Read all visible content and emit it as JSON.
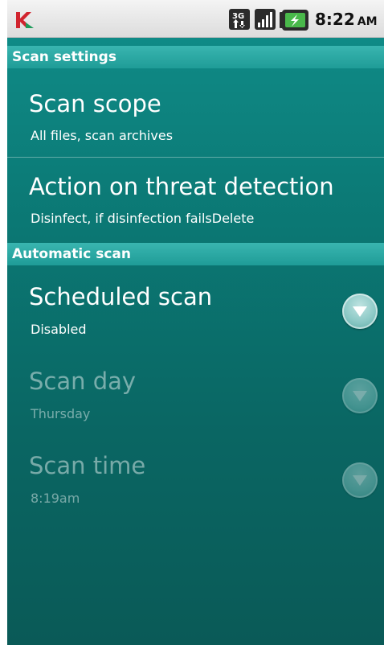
{
  "status_bar": {
    "time": "8:22",
    "ampm": "AM",
    "icons": [
      "kaspersky-logo-icon",
      "3g-data-icon",
      "signal-strength-icon",
      "battery-charging-icon"
    ]
  },
  "sections": {
    "scan_settings": {
      "header": "Scan settings",
      "items": [
        {
          "title": "Scan scope",
          "subtitle": "All files, scan archives"
        },
        {
          "title": "Action on threat detection",
          "subtitle": "Disinfect, if disinfection failsDelete"
        }
      ]
    },
    "automatic_scan": {
      "header": "Automatic scan",
      "items": [
        {
          "title": "Scheduled scan",
          "subtitle": "Disabled",
          "enabled": true
        },
        {
          "title": "Scan day",
          "subtitle": "Thursday",
          "enabled": false
        },
        {
          "title": "Scan time",
          "subtitle": "8:19am",
          "enabled": false
        }
      ]
    }
  },
  "colors": {
    "background": "#0b7874",
    "section_header": "#2aa8a3",
    "text": "#ffffff",
    "logo_red": "#d1252f"
  }
}
